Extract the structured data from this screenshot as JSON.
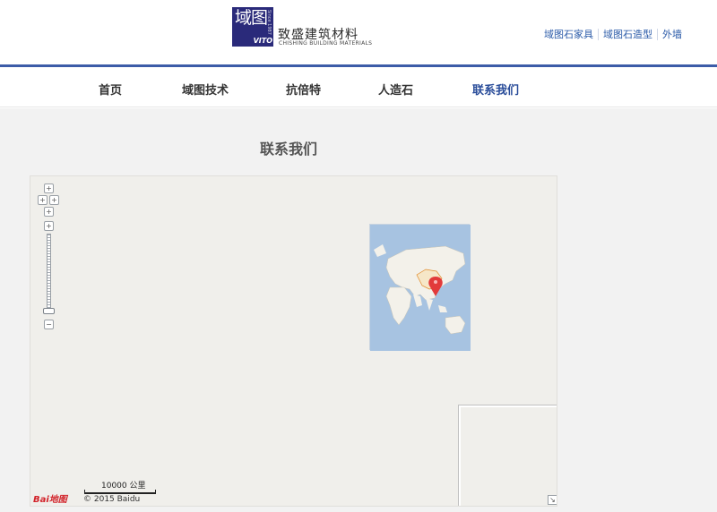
{
  "brand": {
    "name_cn": "致盛建筑材料",
    "name_en": "CHISHING BUILDING MATERIALS",
    "logo_glyph": "域图",
    "logo_vito": "VITO",
    "logo_since": "Since 1987"
  },
  "top_links": [
    "域图石家具",
    "域图石造型",
    "外墙"
  ],
  "nav": [
    {
      "label": "首页",
      "active": false
    },
    {
      "label": "域图技术",
      "active": false
    },
    {
      "label": "抗倍特",
      "active": false
    },
    {
      "label": "人造石",
      "active": false
    },
    {
      "label": "联系我们",
      "active": true
    }
  ],
  "page": {
    "title": "联系我们"
  },
  "map": {
    "scale_label": "10000 公里",
    "copyright": "© 2015 Baidu",
    "logo_text": "Bai地图",
    "marker_color": "#e23a3a",
    "overview_ocean_color": "#a7c3e1",
    "overview_land_color": "#f3f1ea"
  },
  "colors": {
    "accent": "#3c5ca8",
    "active_nav": "#2a4d9a",
    "link": "#2a5aa8"
  }
}
